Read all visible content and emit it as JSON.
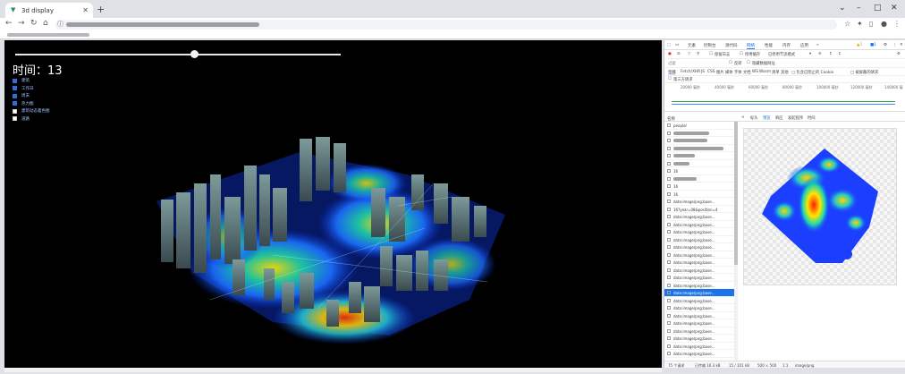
{
  "browser": {
    "tab_title": "3d display",
    "new_tab": "+",
    "window_controls": [
      "⌄",
      "–",
      "□",
      "✕"
    ]
  },
  "viewer": {
    "time_label": "时间：",
    "time_value": "13",
    "slider_progress": 0.55,
    "layers": [
      {
        "label": "建筑",
        "checked": true
      },
      {
        "label": "工作日",
        "checked": true
      },
      {
        "label": "周末",
        "checked": true
      },
      {
        "label": "热力图",
        "checked": true
      },
      {
        "label": "建筑动态着色图",
        "checked": false
      },
      {
        "label": "道路",
        "checked": false
      }
    ]
  },
  "devtools": {
    "tabs": [
      "元素",
      "控制台",
      "源代码",
      "网络",
      "性能",
      "内存",
      "应用",
      "»"
    ],
    "active_tab": "网络",
    "toolbar": {
      "preserve_log": "保留日志",
      "disable_cache": "停用缓存",
      "throttle": "已停用节流模式"
    },
    "filter_row": {
      "filter": "过滤",
      "invert": "反转",
      "hide_data_urls": "隐藏数据网址"
    },
    "type_filters": [
      "全部",
      "Fetch/XHR",
      "JS",
      "CSS",
      "图片",
      "媒体",
      "字体",
      "文档",
      "WS",
      "Wasm",
      "清单",
      "其他",
      "□ 包含已阻止的 Cookie",
      "□ 被屏蔽的请求"
    ],
    "third_party": "第三方请求",
    "timeline_ticks": [
      "20000 毫秒",
      "40000 毫秒",
      "60000 毫秒",
      "80000 毫秒",
      "100000 毫秒",
      "120000 毫秒",
      "140000 毫"
    ],
    "request_header": "名称",
    "requests": [
      {
        "name": "people/",
        "type": "doc"
      },
      {
        "name": "",
        "type": "gray",
        "w": 40
      },
      {
        "name": "",
        "type": "gray",
        "w": 38
      },
      {
        "name": "",
        "type": "gray",
        "w": 56
      },
      {
        "name": "",
        "type": "gray",
        "w": 24
      },
      {
        "name": "",
        "type": "gray",
        "w": 18
      },
      {
        "name": "16",
        "type": "file"
      },
      {
        "name": "",
        "type": "gray",
        "w": 26
      },
      {
        "name": "16",
        "type": "file"
      },
      {
        "name": "16",
        "type": "file"
      },
      {
        "name": "data:image/png;base...",
        "type": "img"
      },
      {
        "name": "16?year=08&position=4",
        "type": "file"
      },
      {
        "name": "data:image/png;base...",
        "type": "img"
      },
      {
        "name": "data:image/png;base...",
        "type": "img"
      },
      {
        "name": "data:image/png;base...",
        "type": "img"
      },
      {
        "name": "data:image/png;base...",
        "type": "img"
      },
      {
        "name": "data:image/png;base...",
        "type": "img"
      },
      {
        "name": "data:image/png;base...",
        "type": "img"
      },
      {
        "name": "data:image/png;base...",
        "type": "img"
      },
      {
        "name": "data:image/png;base...",
        "type": "img"
      },
      {
        "name": "data:image/png;base...",
        "type": "img"
      },
      {
        "name": "data:image/png;base...",
        "type": "img"
      },
      {
        "name": "data:image/png;base...",
        "type": "sel"
      },
      {
        "name": "data:image/png;base...",
        "type": "img"
      },
      {
        "name": "data:image/png;base...",
        "type": "img"
      },
      {
        "name": "data:image/png;base...",
        "type": "img"
      },
      {
        "name": "data:image/png;base...",
        "type": "img"
      },
      {
        "name": "data:image/png;base...",
        "type": "img"
      },
      {
        "name": "data:image/png;base...",
        "type": "img"
      },
      {
        "name": "data:image/png;base...",
        "type": "img"
      },
      {
        "name": "data:image/png;base...",
        "type": "img"
      }
    ],
    "preview_tabs": [
      "×",
      "标头",
      "预览",
      "响应",
      "发起程序",
      "时间"
    ],
    "active_preview_tab": "预览",
    "status": [
      "75 个请求",
      "已传输 16.3 kB",
      "15 / 101 kB",
      "500 × 500",
      "1:1",
      "image/png"
    ]
  }
}
